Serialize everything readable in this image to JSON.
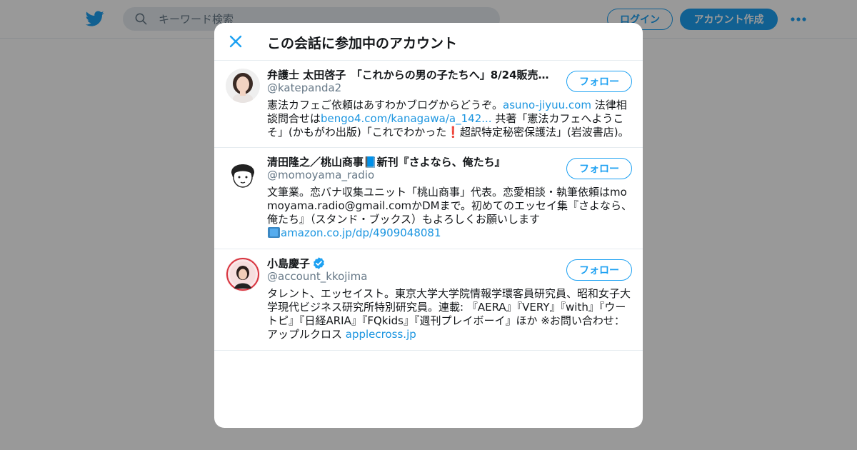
{
  "header": {
    "search_placeholder": "キーワード検索",
    "login_label": "ログイン",
    "signup_label": "アカウント作成"
  },
  "modal": {
    "title": "この会話に参加中のアカウント"
  },
  "accounts": [
    {
      "name": "弁護士 太田啓子　「これからの男の子たちへ」8/24販売（…",
      "handle": "@katepanda2",
      "follow_label": "フォロー",
      "bio_parts": [
        {
          "text": "憲法カフェご依頼はあすわかブログからどうぞ。"
        },
        {
          "text": "asuno-jiyuu.com",
          "link": true
        },
        {
          "text": " 法律相談問合せは"
        },
        {
          "text": "bengo4.com/kanagawa/a_142...",
          "link": true
        },
        {
          "text": " 共著「憲法カフェへようこそ」(かもがわ出版)「これでわかった"
        },
        {
          "text": "❗",
          "excl": true
        },
        {
          "text": "超訳特定秘密保護法」(岩波書店)。"
        }
      ]
    },
    {
      "name": "清田隆之／桃山商事📘新刊『さよなら、俺たち』",
      "handle": "@momoyama_radio",
      "follow_label": "フォロー",
      "bio_parts": [
        {
          "text": "文筆業。恋バナ収集ユニット「桃山商事」代表。恋愛相談・執筆依頼はmomoyama.radio@gmail.comかDMまで。初めてのエッセイ集『さよなら、俺たち』（スタンド・ブックス）もよろしくお願いします"
        },
        {
          "text": "",
          "book": true
        },
        {
          "text": "amazon.co.jp/dp/4909048081",
          "link": true
        }
      ]
    },
    {
      "name": "小島慶子",
      "verified": true,
      "handle": "@account_kkojima",
      "follow_label": "フォロー",
      "bio_parts": [
        {
          "text": "タレント、エッセイスト。東京大学大学院情報学環客員研究員、昭和女子大学現代ビジネス研究所特別研究員。連載: 『AERA』『VERY』『with』『ウートピ』『日経ARIA』『FQkids』『週刊プレイボーイ』ほか ※お問い合わせ：アップルクロス "
        },
        {
          "text": "applecross.jp",
          "link": true
        }
      ]
    }
  ],
  "colors": {
    "brand": "#1da1f2",
    "link": "#1b95e0",
    "text": "#14171a",
    "secondary_text": "#657786",
    "verified": "#1da1f2"
  },
  "icons": [
    "twitter-bird-icon",
    "search-icon",
    "more-icon",
    "close-icon",
    "verified-badge-icon"
  ]
}
